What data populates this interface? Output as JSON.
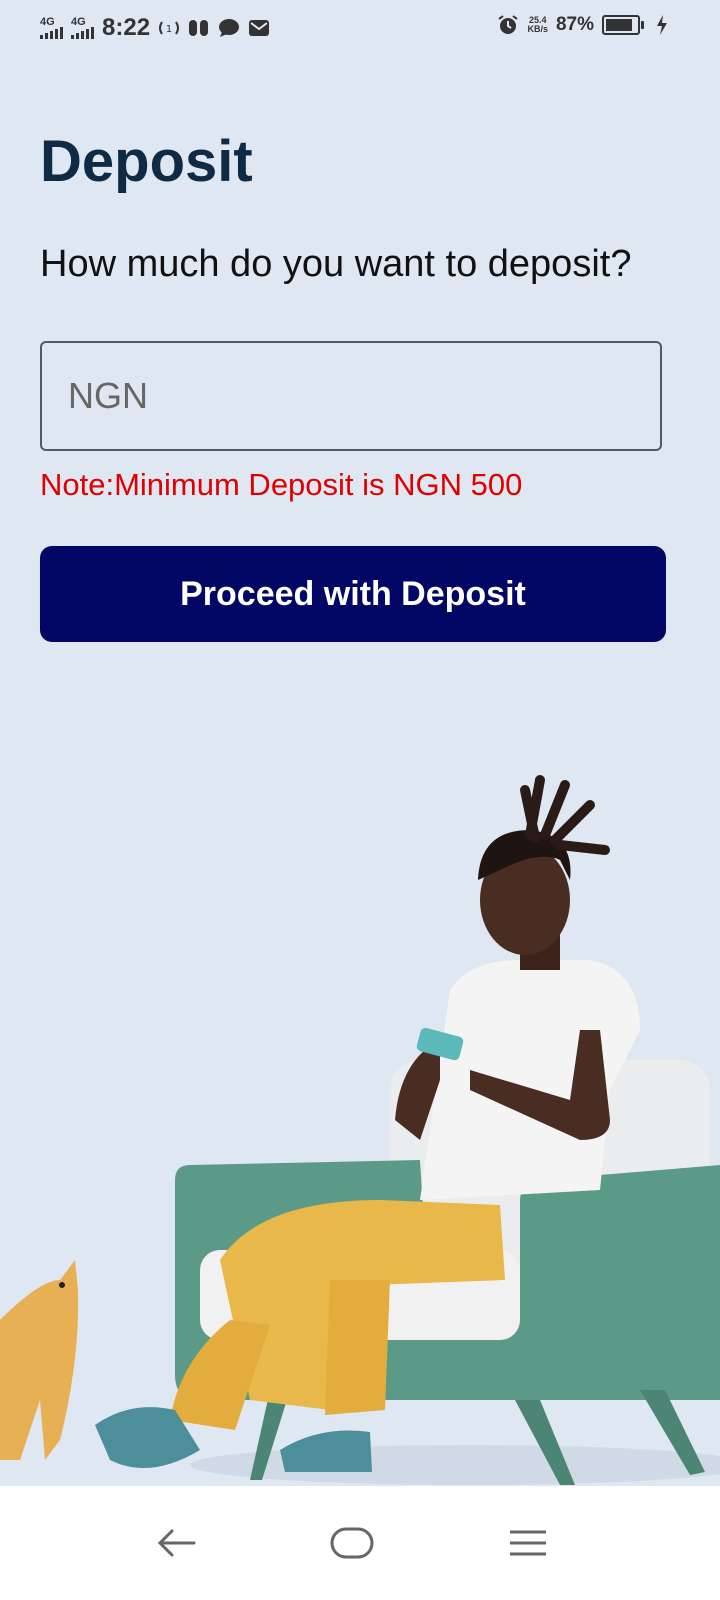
{
  "status_bar": {
    "network_1": "4G",
    "network_2": "4G",
    "time": "8:22",
    "speed_value": "25.4",
    "speed_unit": "KB/s",
    "battery_percent_label": "87%",
    "battery_level": 0.87,
    "icons": [
      "signal-icon",
      "signal-icon",
      "hotspot-icon",
      "app-notification-icon",
      "chat-icon",
      "mail-icon",
      "alarm-icon",
      "battery-icon",
      "charging-icon"
    ]
  },
  "page": {
    "title": "Deposit",
    "question": "How much do you want to deposit?",
    "amount_placeholder": "NGN",
    "amount_value": "",
    "note": "Note:Minimum Deposit is NGN 500",
    "proceed_label": "Proceed with Deposit"
  },
  "colors": {
    "background": "#dfe8f2",
    "title": "#0f2a44",
    "note": "#e10000",
    "button": "#020765",
    "chair": "#5b9a86",
    "pants": "#e8b84a"
  },
  "nav_bar": {
    "buttons": [
      "back-icon",
      "home-icon",
      "menu-icon"
    ]
  }
}
